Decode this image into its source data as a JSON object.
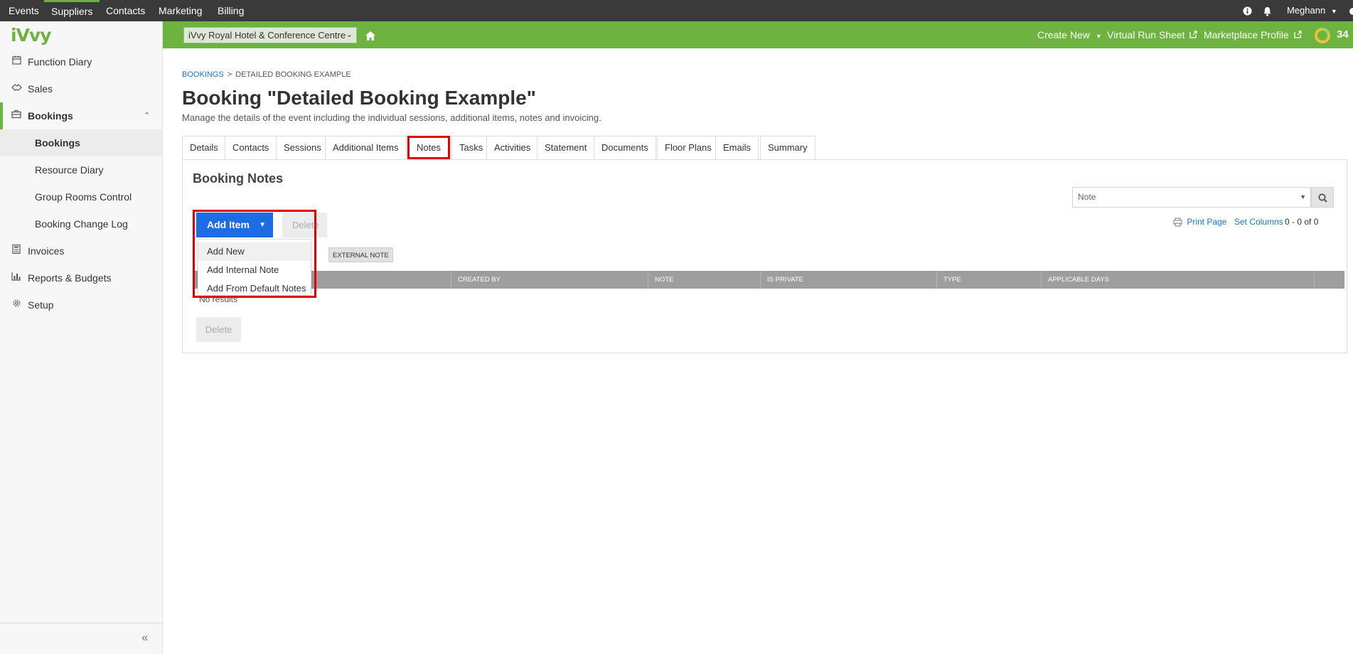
{
  "topnav": {
    "items": [
      "Events",
      "Suppliers",
      "Contacts",
      "Marketing",
      "Billing"
    ],
    "active": "Suppliers",
    "user": "Meghann"
  },
  "greenbar": {
    "venue": "iVvy Royal Hotel & Conference Centre",
    "create_new": "Create New",
    "virtual_run_sheet": "Virtual Run Sheet",
    "marketplace_profile": "Marketplace Profile",
    "score": "34"
  },
  "sidebar": {
    "logo": "iVvy",
    "items": [
      {
        "label": "Function Diary",
        "icon": "calendar-icon"
      },
      {
        "label": "Sales",
        "icon": "sales-icon"
      },
      {
        "label": "Bookings",
        "icon": "briefcase-icon"
      },
      {
        "label": "Bookings"
      },
      {
        "label": "Resource Diary"
      },
      {
        "label": "Group Rooms Control"
      },
      {
        "label": "Booking Change Log"
      },
      {
        "label": "Invoices",
        "icon": "calculator-icon"
      },
      {
        "label": "Reports & Budgets",
        "icon": "chart-icon"
      },
      {
        "label": "Setup",
        "icon": "gear-icon"
      }
    ]
  },
  "breadcrumb": {
    "root": "BOOKINGS",
    "separator": ">",
    "current": "DETAILED BOOKING EXAMPLE"
  },
  "page": {
    "title": "Booking \"Detailed Booking Example\"",
    "description": "Manage the details of the event including the individual sessions, additional items, notes and invoicing."
  },
  "tabs": [
    "Details",
    "Contacts",
    "Sessions",
    "Additional Items",
    "Notes",
    "Tasks",
    "Activities",
    "Statement",
    "Documents",
    "Floor Plans",
    "Emails",
    "Summary"
  ],
  "active_tab": "Notes",
  "notes": {
    "panel_title": "Booking Notes",
    "filter_value": "Note",
    "print_page": "Print Page",
    "set_columns": "Set Columns",
    "page_count": "0 - 0 of 0",
    "add_item": "Add Item",
    "delete_top": "Delete",
    "tag": "EXTERNAL NOTE",
    "columns": [
      "CREATED BY",
      "NOTE",
      "IS PRIVATE",
      "TYPE",
      "APPLICABLE DAYS"
    ],
    "no_results": "No results",
    "delete_bottom": "Delete",
    "dropdown": [
      "Add New",
      "Add Internal Note",
      "Add From Default Notes"
    ]
  },
  "colors": {
    "brand_green": "#6db33f",
    "topbar": "#3a3a3a",
    "primary_blue": "#1c6ce6",
    "highlight_red": "#e00000"
  }
}
